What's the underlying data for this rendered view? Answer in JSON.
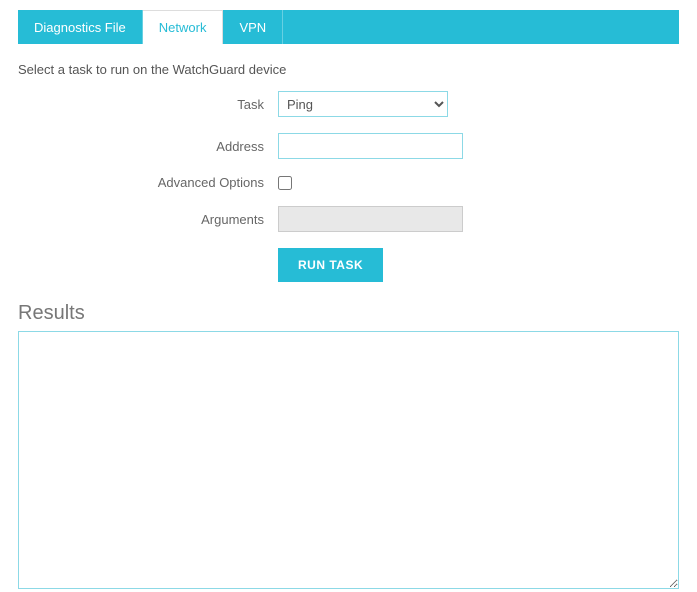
{
  "tabs": {
    "diagnostics_file": "Diagnostics File",
    "network": "Network",
    "vpn": "VPN"
  },
  "instruction": "Select a task to run on the WatchGuard device",
  "form": {
    "task_label": "Task",
    "task_value": "Ping",
    "address_label": "Address",
    "address_value": "",
    "advanced_options_label": "Advanced Options",
    "advanced_options_checked": false,
    "arguments_label": "Arguments",
    "arguments_value": ""
  },
  "buttons": {
    "run_task": "RUN TASK"
  },
  "results": {
    "heading": "Results",
    "content": ""
  }
}
